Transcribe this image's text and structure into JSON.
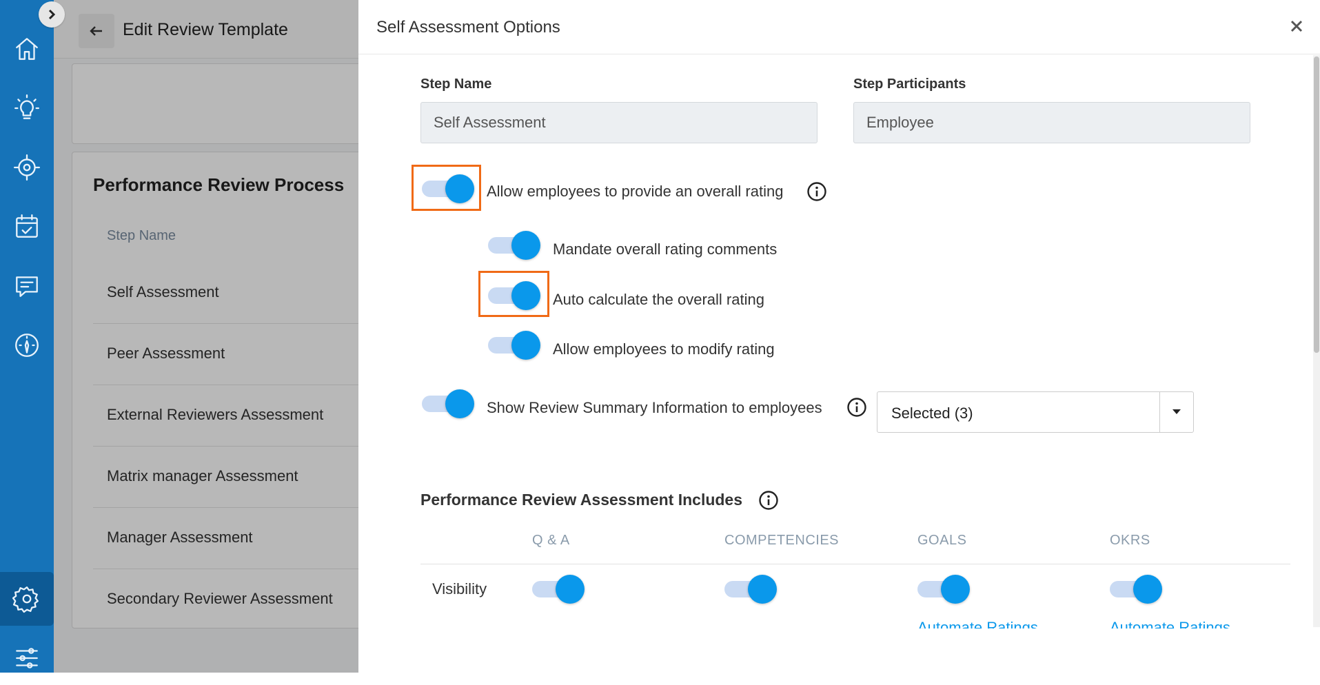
{
  "background_page": {
    "title": "Edit Review Template",
    "section_title": "Performance Review Process",
    "column_header": "Step Name",
    "rows": [
      "Self Assessment",
      "Peer Assessment",
      "External Reviewers Assessment",
      "Matrix manager Assessment",
      "Manager Assessment",
      "Secondary Reviewer Assessment"
    ]
  },
  "nav": {
    "items": [
      "home-icon",
      "lightbulb-icon",
      "target-icon",
      "calendar-check-icon",
      "comment-icon",
      "gauge-icon",
      "gear-icon",
      "sliders-icon"
    ]
  },
  "panel": {
    "title": "Self Assessment Options",
    "step_name_label": "Step Name",
    "step_name_value": "Self Assessment",
    "step_participants_label": "Step Participants",
    "step_participants_value": "Employee",
    "options": {
      "overall_rating": "Allow employees to provide an overall rating",
      "mandate_comments": "Mandate overall rating comments",
      "auto_calculate": "Auto calculate the overall rating",
      "modify_rating": "Allow employees to modify rating",
      "show_summary": "Show Review Summary Information to employees"
    },
    "summary_dropdown_value": "Selected (3)",
    "includes_title": "Performance Review Assessment Includes",
    "columns": [
      "Q & A",
      "COMPETENCIES",
      "GOALS",
      "OKRS"
    ],
    "visibility_label": "Visibility",
    "automate_ratings": "Automate Ratings"
  },
  "colors": {
    "accent": "#0a98eb",
    "nav": "#1673b8",
    "highlight": "#f06a16"
  }
}
